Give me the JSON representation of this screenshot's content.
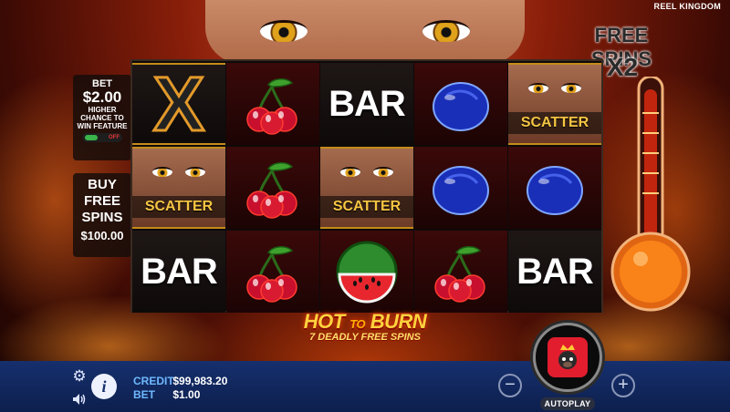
{
  "provider": "REEL KINGDOM",
  "free_spins": {
    "label": "FREE SPINS",
    "multiplier": "X2"
  },
  "bet_panel": {
    "title": "BET",
    "amount": "$2.00",
    "desc": "HIGHER CHANCE TO WIN FEATURE",
    "toggle_state": "OFF"
  },
  "buy_panel": {
    "line1": "BUY",
    "line2": "FREE",
    "line3": "SPINS",
    "price": "$100.00"
  },
  "reels": {
    "rows": [
      [
        "X",
        "cherry-icon",
        "BAR",
        "plum-icon",
        "SCATTER"
      ],
      [
        "SCATTER",
        "cherry-icon",
        "SCATTER",
        "plum-icon",
        "plum-icon"
      ],
      [
        "BAR",
        "cherry-icon",
        "watermelon-icon",
        "cherry-icon",
        "BAR"
      ]
    ],
    "scatter_label": "SCATTER",
    "bar_label": "BAR",
    "x_label": "X"
  },
  "logo": {
    "hot": "HOT",
    "to": "TO",
    "burn": "BURN",
    "subtitle": "7 DEADLY FREE SPINS"
  },
  "bottom": {
    "credit_label": "CREDIT",
    "credit_value": "$99,983.20",
    "bet_label": "BET",
    "bet_value": "$1.00",
    "info_label": "i",
    "minus": "−",
    "plus": "+",
    "autoplay": "AUTOPLAY"
  },
  "colors": {
    "accent": "#f5c542",
    "bottom_bar": "#16306e",
    "spin_button": "#e11d2e"
  }
}
